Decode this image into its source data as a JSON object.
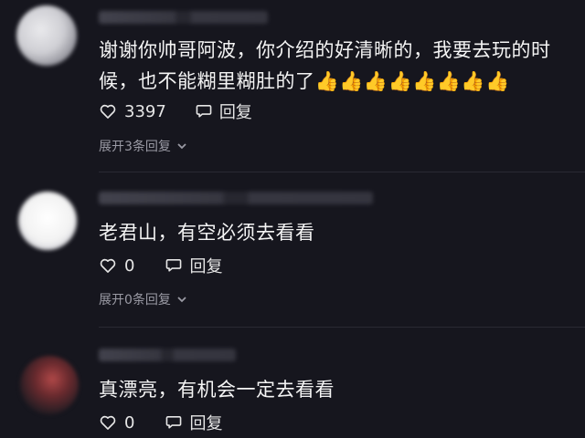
{
  "comments": [
    {
      "text": "谢谢你帅哥阿波，你介绍的好清晰的，我要去玩的时候，也不能糊里糊肚的了👍👍👍👍👍👍👍👍",
      "likes": "3397",
      "reply_label": "回复",
      "expand_label": "展开3条回复"
    },
    {
      "text": "老君山，有空必须去看看",
      "likes": "0",
      "reply_label": "回复",
      "expand_label": "展开0条回复"
    },
    {
      "text": "真漂亮，有机会一定去看看",
      "likes": "0",
      "reply_label": "回复"
    }
  ],
  "icons": {
    "like": "heart-outline-icon",
    "reply": "speech-bubble-icon",
    "expand": "chevron-down-icon"
  },
  "colors": {
    "background": "#16161e",
    "text": "#f4f4f4",
    "muted": "#9a9aa4"
  }
}
